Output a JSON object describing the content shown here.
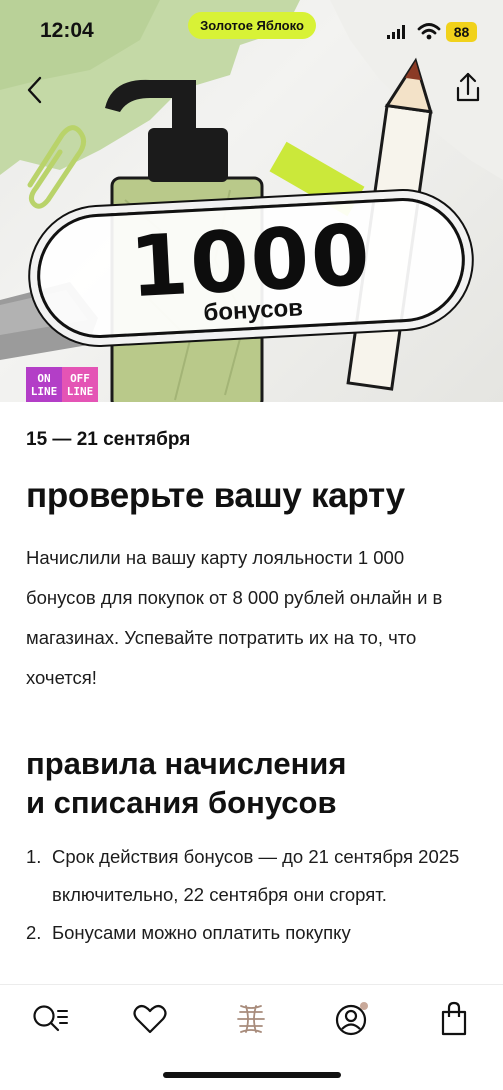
{
  "status_bar": {
    "time": "12:04",
    "app_pill": "Золотое Яблоко",
    "battery": "88",
    "icons": [
      "signal-icon",
      "wifi-icon"
    ]
  },
  "hero": {
    "promo_number": "1000",
    "promo_caption": "бонусов",
    "badges": [
      {
        "line1": "ON",
        "line2": "LINE"
      },
      {
        "line1": "OFF",
        "line2": "LINE"
      }
    ],
    "accent_color": "#d8f236"
  },
  "nav": {
    "back_icon": "chevron-left-icon",
    "share_icon": "share-icon"
  },
  "content": {
    "date_range": "15 — 21 сентября",
    "title": "проверьте вашу карту",
    "description": "Начислили на вашу карту лояльности 1 000 бонусов для покупок от 8 000 рублей онлайн и в магазинах. Успевайте потратить их на то, что хочется!",
    "rules_title": "правила начисления\nи списания бонусов",
    "rules": [
      {
        "num": "1.",
        "text": "Срок действия бонусов — до 21 сентября 2025 включительно, 22 сентября они сгорят."
      },
      {
        "num": "2.",
        "text": "Бонусами можно оплатить покупку"
      }
    ]
  },
  "tab_bar": {
    "items": [
      "search-catalog-icon",
      "favorites-icon",
      "brand-logo-icon",
      "profile-icon",
      "bag-icon"
    ],
    "notification_dot_color": "#c9a99a"
  }
}
